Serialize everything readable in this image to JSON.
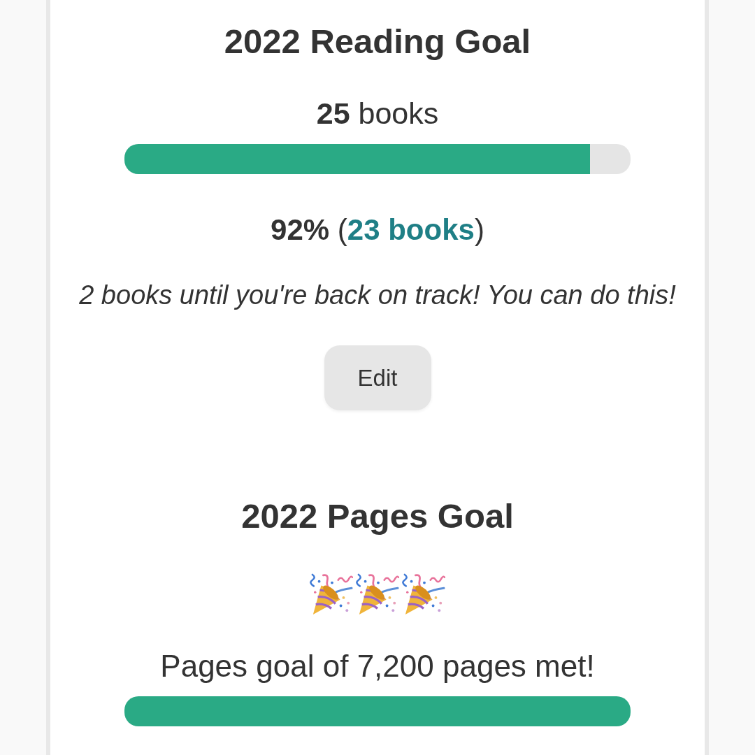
{
  "reading_goal": {
    "title": "2022 Reading Goal",
    "target": "**25** books",
    "progress_bar": {
      "level": 0.92
    },
    "progress_line": {
      "before": "**92%** (",
      "link": "23 books",
      "after": ")"
    },
    "message": "2 books until you're back on track! You can do this!",
    "edit_button": "Edit"
  },
  "pages_goal": {
    "title": "2022 Pages Goal",
    "celebration": [
      {
        "kind": "party-popper"
      },
      {
        "kind": "party-popper"
      },
      {
        "kind": "party-popper"
      }
    ],
    "message": "Pages goal of 7,200 pages met!",
    "progress_bar": {
      "level": 1
    }
  }
}
